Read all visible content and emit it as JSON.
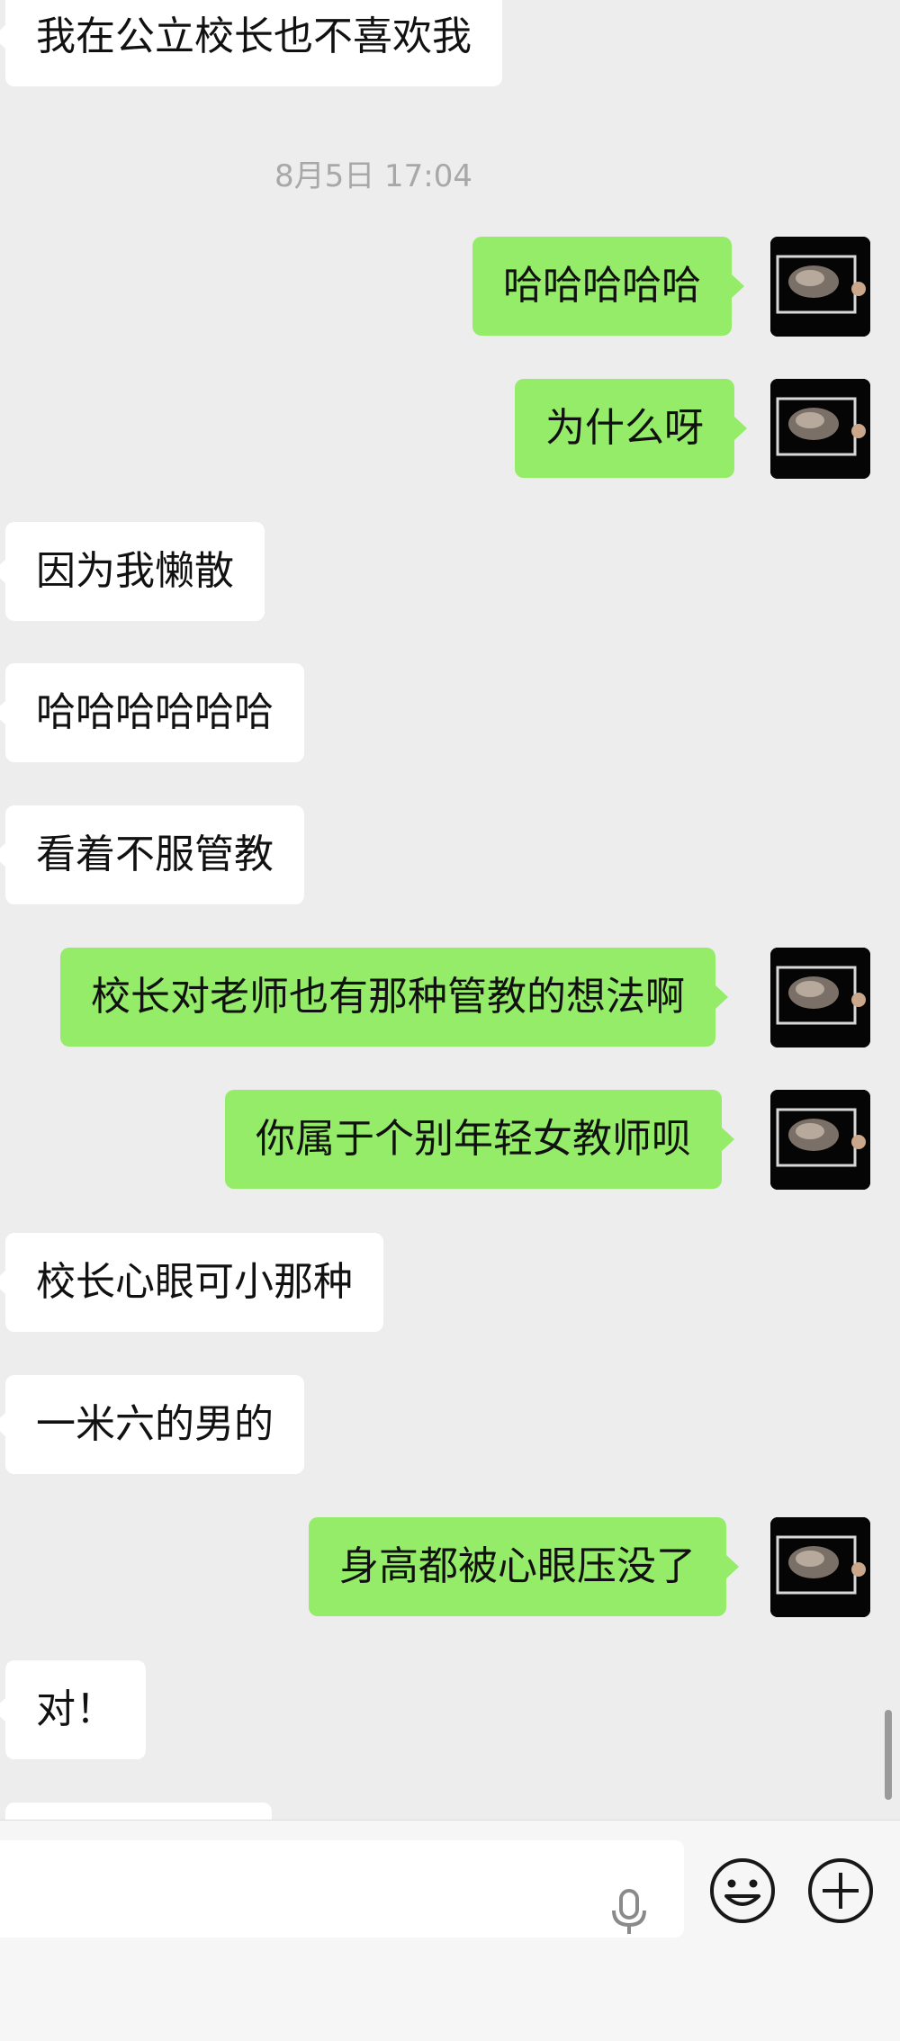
{
  "timestamp": "8月5日 17:04",
  "messages": [
    {
      "text": "我在公立校长也不喜欢我",
      "side": "in"
    },
    {
      "text": "哈哈哈哈哈",
      "side": "out"
    },
    {
      "text": "为什么呀",
      "side": "out"
    },
    {
      "text": "因为我懒散",
      "side": "in"
    },
    {
      "text": "哈哈哈哈哈哈",
      "side": "in"
    },
    {
      "text": "看着不服管教",
      "side": "in"
    },
    {
      "text": "校长对老师也有那种管教的想法啊",
      "side": "out"
    },
    {
      "text": "你属于个别年轻女教师呗",
      "side": "out"
    },
    {
      "text": "校长心眼可小那种",
      "side": "in"
    },
    {
      "text": "一米六的男的",
      "side": "in"
    },
    {
      "text": "身高都被心眼压没了",
      "side": "out"
    },
    {
      "text": "对！",
      "side": "in"
    }
  ],
  "input_bar": {
    "text_value": "",
    "icons": [
      "microphone-icon",
      "emoji-icon",
      "plus-icon"
    ]
  },
  "colors": {
    "background": "#ededed",
    "outgoing_bubble": "#95ec69",
    "incoming_bubble": "#ffffff",
    "timestamp_text": "#a8a8a8"
  }
}
